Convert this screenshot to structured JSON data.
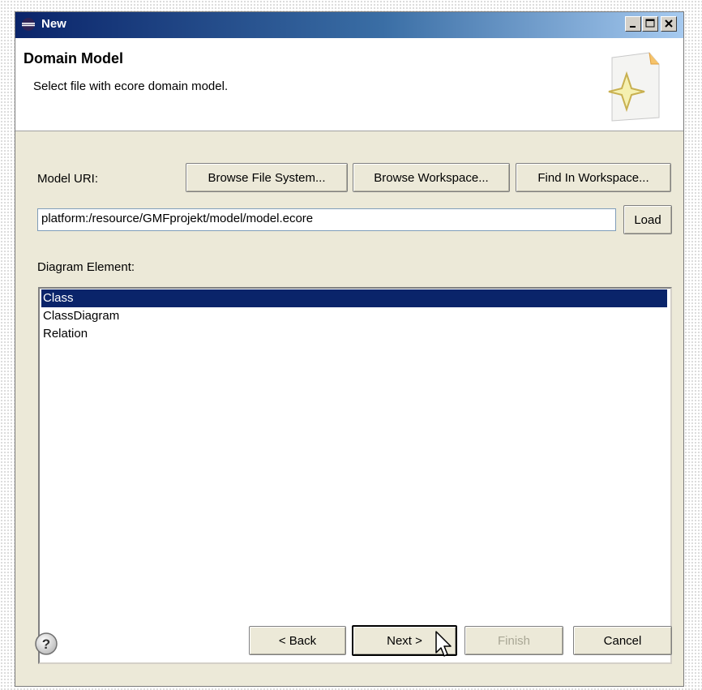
{
  "window": {
    "title": "New",
    "title_icon": "eclipse-icon",
    "controls": {
      "minimize": "minimize-icon",
      "maximize": "maximize-icon",
      "close": "close-icon"
    }
  },
  "header": {
    "title": "Domain Model",
    "description": "Select file with ecore domain model.",
    "image_icon": "wizard-banner-icon"
  },
  "form": {
    "model_uri_label": "Model URI:",
    "browse_file_system": "Browse File System...",
    "browse_workspace": "Browse Workspace...",
    "find_in_workspace": "Find In Workspace...",
    "model_uri_value": "platform:/resource/GMFprojekt/model/model.ecore",
    "load_button": "Load",
    "diagram_element_label": "Diagram Element:",
    "diagram_elements": [
      "Class",
      "ClassDiagram",
      "Relation"
    ],
    "selected_element": "Class"
  },
  "footer": {
    "help_icon": "help-icon",
    "back": "< Back",
    "next": "Next >",
    "finish": "Finish",
    "cancel": "Cancel"
  },
  "colors": {
    "titlebar_start": "#0a246a",
    "titlebar_end": "#a6caf0",
    "selection": "#0a246a",
    "dialog_bg": "#ece9d8"
  }
}
